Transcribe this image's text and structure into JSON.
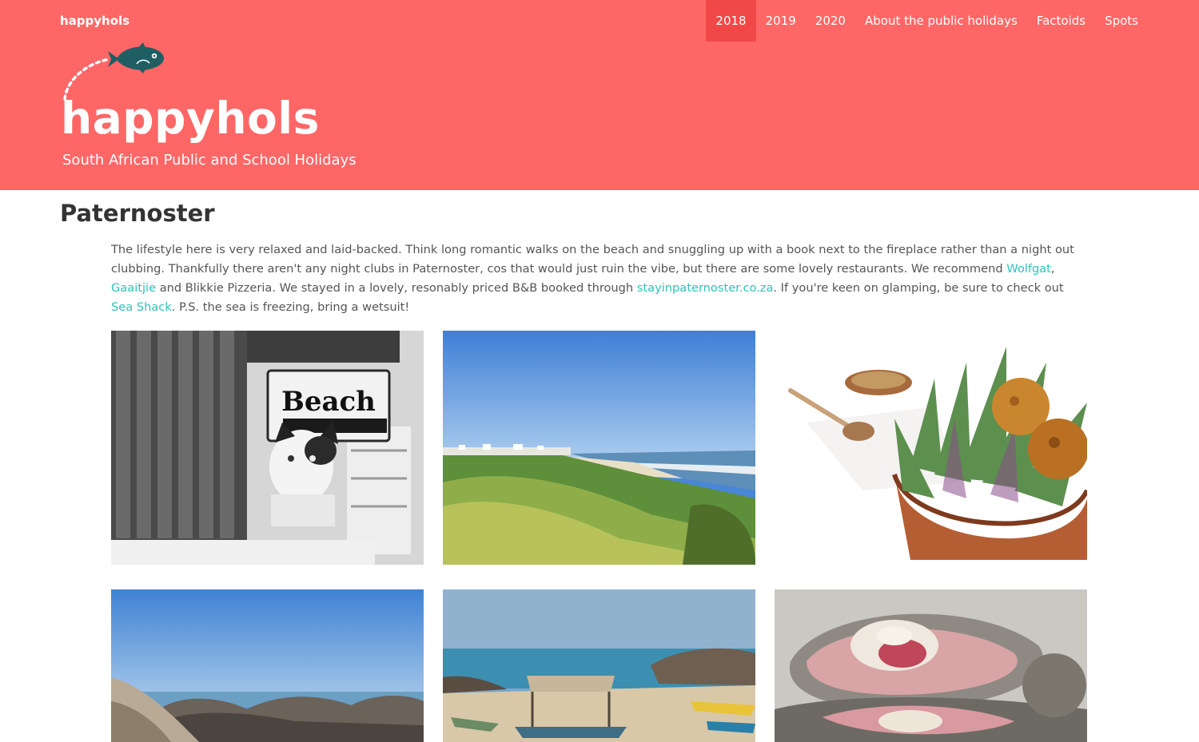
{
  "site": {
    "brand": "happyhols",
    "logo_text": "happyhols",
    "tagline": "South African Public and School Holidays"
  },
  "nav": {
    "items": [
      {
        "label": "2018",
        "active": true
      },
      {
        "label": "2019",
        "active": false
      },
      {
        "label": "2020",
        "active": false
      },
      {
        "label": "About the public holidays",
        "active": false
      },
      {
        "label": "Factoids",
        "active": false
      },
      {
        "label": "Spots",
        "active": false
      }
    ]
  },
  "main": {
    "title": "Paternoster",
    "intro": {
      "text1": "The lifestyle here is very relaxed and laid-backed. Think long romantic walks on the beach and snuggling up with a book next to the fireplace rather than a night out clubbing. Thankfully there aren't any night clubs in Paternoster, cos that would just ruin the vibe, but there are some lovely restaurants. We recommend ",
      "link1": "Wolfgat",
      "sep1": ", ",
      "link2": "Gaaitjie",
      "text2": " and Blikkie Pizzeria. We stayed in a lovely, resonably priced B&B booked through ",
      "link3": "stayinpaternoster.co.za",
      "text3": ". If you're keen on glamping, be sure to check out ",
      "link4": "Sea Shack",
      "text4": ". P.S. the sea is freezing, bring a wetsuit!"
    },
    "photos": {
      "sign_text": "Beach"
    }
  },
  "colors": {
    "header_bg": "#ff6666",
    "nav_active_bg": "#f04848",
    "link": "#2ec3bb",
    "fish": "#1f5f63"
  }
}
